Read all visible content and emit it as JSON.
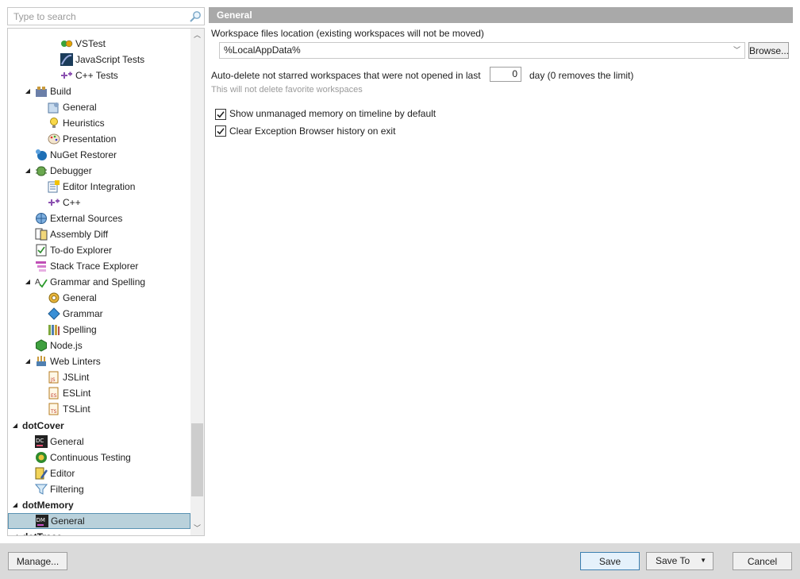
{
  "search": {
    "placeholder": "Type to search"
  },
  "tree": [
    {
      "label": "VSTest",
      "icon": "vstest-icon",
      "level": 3,
      "expander": ""
    },
    {
      "label": "JavaScript Tests",
      "icon": "javascript-tests-icon",
      "level": 3,
      "expander": ""
    },
    {
      "label": "C++ Tests",
      "icon": "cpp-tests-icon",
      "level": 3,
      "expander": ""
    },
    {
      "label": "Build",
      "icon": "build-icon",
      "level": 1,
      "expander": "◢"
    },
    {
      "label": "General",
      "icon": "build-general-icon",
      "level": 2,
      "expander": ""
    },
    {
      "label": "Heuristics",
      "icon": "lightbulb-icon",
      "level": 2,
      "expander": ""
    },
    {
      "label": "Presentation",
      "icon": "palette-icon",
      "level": 2,
      "expander": ""
    },
    {
      "label": "NuGet Restorer",
      "icon": "nuget-icon",
      "level": 1,
      "expander": ""
    },
    {
      "label": "Debugger",
      "icon": "debugger-icon",
      "level": 1,
      "expander": "◢"
    },
    {
      "label": "Editor Integration",
      "icon": "editor-integration-icon",
      "level": 2,
      "expander": ""
    },
    {
      "label": "C++",
      "icon": "cpp-icon",
      "level": 2,
      "expander": ""
    },
    {
      "label": "External Sources",
      "icon": "external-sources-icon",
      "level": 1,
      "expander": ""
    },
    {
      "label": "Assembly Diff",
      "icon": "assembly-diff-icon",
      "level": 1,
      "expander": ""
    },
    {
      "label": "To-do Explorer",
      "icon": "todo-icon",
      "level": 1,
      "expander": ""
    },
    {
      "label": "Stack Trace Explorer",
      "icon": "stack-trace-icon",
      "level": 1,
      "expander": ""
    },
    {
      "label": "Grammar and Spelling",
      "icon": "grammar-spelling-icon",
      "level": 1,
      "expander": "◢"
    },
    {
      "label": "General",
      "icon": "gear-icon",
      "level": 2,
      "expander": ""
    },
    {
      "label": "Grammar",
      "icon": "grammar-icon",
      "level": 2,
      "expander": ""
    },
    {
      "label": "Spelling",
      "icon": "spelling-icon",
      "level": 2,
      "expander": ""
    },
    {
      "label": "Node.js",
      "icon": "nodejs-icon",
      "level": 1,
      "expander": ""
    },
    {
      "label": "Web Linters",
      "icon": "web-linters-icon",
      "level": 1,
      "expander": "◢"
    },
    {
      "label": "JSLint",
      "icon": "jslint-icon",
      "level": 2,
      "expander": ""
    },
    {
      "label": "ESLint",
      "icon": "eslint-icon",
      "level": 2,
      "expander": ""
    },
    {
      "label": "TSLint",
      "icon": "tslint-icon",
      "level": 2,
      "expander": ""
    },
    {
      "label": "dotCover",
      "icon": "",
      "level": 0,
      "expander": "◢",
      "category": true
    },
    {
      "label": "General",
      "icon": "dotcover-icon",
      "level": 1,
      "expander": ""
    },
    {
      "label": "Continuous Testing",
      "icon": "continuous-testing-icon",
      "level": 1,
      "expander": ""
    },
    {
      "label": "Editor",
      "icon": "editor-icon",
      "level": 1,
      "expander": ""
    },
    {
      "label": "Filtering",
      "icon": "filter-icon",
      "level": 1,
      "expander": ""
    },
    {
      "label": "dotMemory",
      "icon": "",
      "level": 0,
      "expander": "◢",
      "category": true
    },
    {
      "label": "General",
      "icon": "dotmemory-icon",
      "level": 1,
      "expander": "",
      "selected": true
    },
    {
      "label": "dotTrace",
      "icon": "",
      "level": 0,
      "expander": "◢",
      "category": true
    }
  ],
  "header": {
    "title": "General"
  },
  "workspace": {
    "label": "Workspace files location (existing workspaces will not be moved)",
    "value": "%LocalAppData%",
    "browse_label": "Browse..."
  },
  "autodelete": {
    "label_before": "Auto-delete not starred workspaces that were not opened in last",
    "value": "0",
    "label_after": "day  (0 removes the limit)",
    "hint": "This will not delete favorite workspaces"
  },
  "options": [
    {
      "label": "Show unmanaged memory on timeline by default",
      "checked": true
    },
    {
      "label": "Clear Exception Browser history on exit",
      "checked": true
    }
  ],
  "footer": {
    "manage_label": "Manage...",
    "save_label": "Save",
    "save_to_label": "Save To",
    "cancel_label": "Cancel"
  },
  "colors": {
    "header_bg": "#a9a9a9",
    "selected_bg": "#b9d1db",
    "footer_bg": "#dadada"
  }
}
